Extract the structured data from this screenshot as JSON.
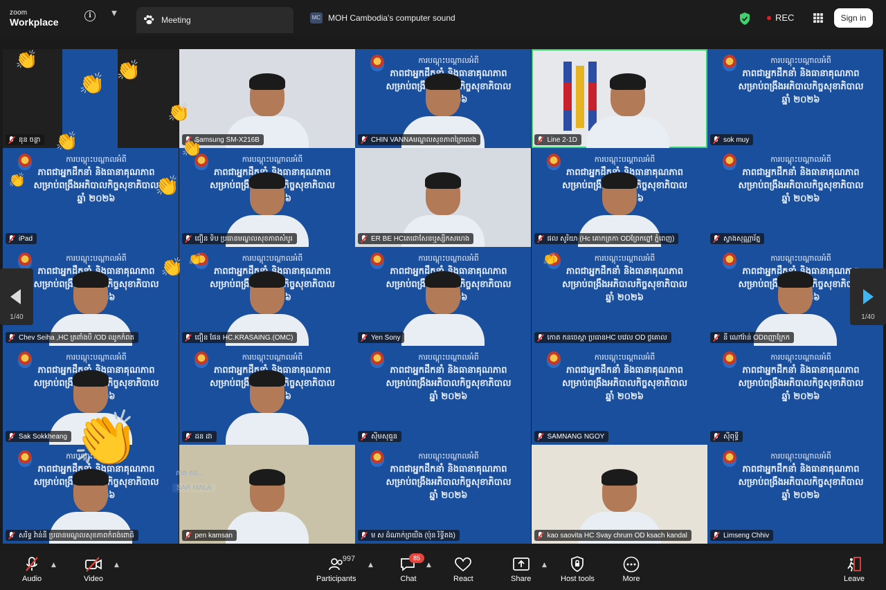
{
  "app": {
    "brand_top": "zoom",
    "brand_bottom": "Workplace"
  },
  "tabs": {
    "meeting": "Meeting",
    "sound_badge": "MC",
    "sound": "MOH Cambodia's computer sound"
  },
  "status": {
    "rec": "REC",
    "signin": "Sign in"
  },
  "banner": {
    "l1": "ការបណ្ដុះបណ្ដាលអំពី",
    "l2": "ភាពជាអ្នកដឹកនាំ និងធានាគុណភាព",
    "l3": "សម្រាប់ពង្រឹងអភិបាលកិច្ចសុខាភិបាល",
    "l4": "ឆ្នាំ ២០២៦"
  },
  "tiles": [
    {
      "name": "នុន ចន្ថា",
      "kind": "self"
    },
    {
      "name": "Samsung SM-X216B",
      "kind": "video"
    },
    {
      "name": "CHIN VANNAមណ្ឌលសុខភាពព្រៃលេង",
      "kind": "video"
    },
    {
      "name": "Line 2-1D",
      "kind": "video"
    },
    {
      "name": "sok muy",
      "kind": "banner"
    },
    {
      "name": "iPad",
      "kind": "banner"
    },
    {
      "name": "ជឿន ទិប ប្រធានមណ្ឌលសុខភាពសំបូរ",
      "kind": "video"
    },
    {
      "name": "ER BE HCតេជោសែនឬស្សីកសហេង",
      "kind": "video"
    },
    {
      "name": "ផល សូរិយា (Hc គោកត្រកា ODព្រែកព្នៅ ភ្នំពេញ)",
      "kind": "video"
    },
    {
      "name": "ស្វាងសុណ្ណារ័ត្ន",
      "kind": "banner"
    },
    {
      "name": "Chev Seiha ,HC ត្រពាំងបី /OD ឈូកកំពត",
      "kind": "video"
    },
    {
      "name": "ជឿន ផែន HC.KRASAING.(OMC)",
      "kind": "video"
    },
    {
      "name": "Yen Sony",
      "kind": "banner"
    },
    {
      "name": "កោត កនចេស្តា ប្រធានHC បវេល OD ថ្ងគោល",
      "kind": "banner"
    },
    {
      "name": "នី ណៅរ៉ាន់ ODពញាក្រែក",
      "kind": "video"
    },
    {
      "name": "Sak Sokkheang",
      "kind": "video"
    },
    {
      "name": "ដន ដា",
      "kind": "video"
    },
    {
      "name": "សុីមសុធួន",
      "kind": "banner"
    },
    {
      "name": "SAMNANG NGOY",
      "kind": "banner"
    },
    {
      "name": "ស៊ីពុទ្ធី",
      "kind": "banner"
    },
    {
      "name": "សរិទ្ធ វ៉ាន់នី ប្រធានមណ្ឌលសុខភាពកំពង់ពោធិ",
      "kind": "video"
    },
    {
      "name": "pen kamsan",
      "kind": "video"
    },
    {
      "name": "ម ស ដំណាក់ព្រយឹង (ប៉ុន រិទ្ធីតង)",
      "kind": "banner"
    },
    {
      "name": "kao saovita HC Svay chrum OD ksach kandal",
      "kind": "video"
    },
    {
      "name": "Limseng Chhiv",
      "kind": "banner"
    }
  ],
  "overlay_labels": {
    "sar_mala": "SAR MALA",
    "ghost": "ភាគ កន..."
  },
  "paging": {
    "left": "1/40",
    "right": "1/40"
  },
  "toolbar": {
    "audio": "Audio",
    "video": "Video",
    "participants": "Participants",
    "participants_count": "997",
    "chat": "Chat",
    "chat_badge": "85",
    "react": "React",
    "share": "Share",
    "host_tools": "Host tools",
    "more": "More",
    "leave": "Leave"
  },
  "colors": {
    "tile_blue": "#1a4f9e",
    "active_border": "#3fd16e",
    "leave_red": "#e5453d"
  }
}
